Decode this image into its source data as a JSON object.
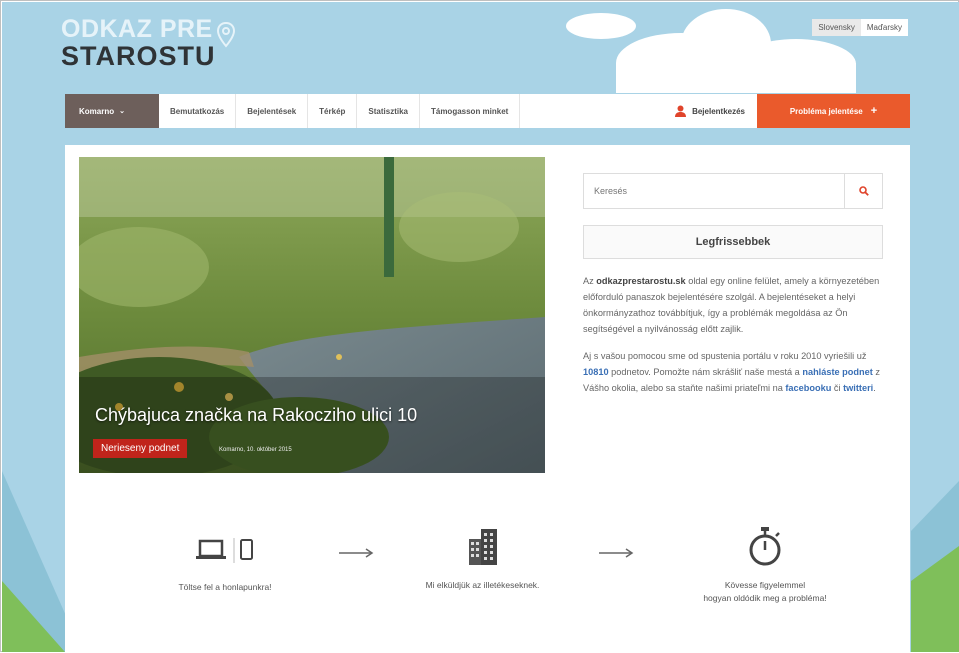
{
  "logo": {
    "line1": "ODKAZ PRE",
    "line2": "STAROSTU"
  },
  "languages": [
    {
      "label": "Slovensky",
      "active": false
    },
    {
      "label": "Maďarsky",
      "active": true
    }
  ],
  "nav": {
    "city": "Komarno",
    "items": [
      "Bemutatkozás",
      "Bejelentések",
      "Térkép",
      "Statisztika",
      "Támogasson minket"
    ],
    "login": "Bejelentkezés",
    "report": "Probléma jelentése"
  },
  "featured": {
    "title": "Chýbajuca značka na Rakocziho ulici 10",
    "status": "Nerieseny podnet",
    "meta": "Komarno, 10. október 2015"
  },
  "search": {
    "placeholder": "Keresés"
  },
  "latest_label": "Legfrissebbek",
  "description": {
    "p1_strong": "odkazprestarostu.sk",
    "p1_pre": "Az",
    "p1_rest": "oldal egy online felület, amely a környezetében előforduló panaszok bejelentésére szolgál. A bejelentéseket a helyi önkormányzathoz továbbítjuk, így a problémák megoldása az Ön segítségével a nyilvánosság előtt zajlik.",
    "p2_pre": "Aj s vašou pomocou sme od spustenia portálu v roku 2010 vyriešili už",
    "p2_count": "10810",
    "p2_mid": "podnetov. Pomožte nám skrášliť naše mestá a",
    "p2_link1": "nahláste podnet",
    "p2_mid2": "z Vášho okolia, alebo sa staňte našimi priateľmi na",
    "p2_link2": "facebooku",
    "p2_or": "či",
    "p2_link3": "twitteri",
    "p2_end": "."
  },
  "steps": [
    {
      "icon": "laptop-phone-icon",
      "text1": "Töltse fel a honlapunkra!",
      "text2": ""
    },
    {
      "icon": "building-icon",
      "text1": "Mi elküldjük az illetékeseknek.",
      "text2": ""
    },
    {
      "icon": "stopwatch-icon",
      "text1": "Kövesse figyelemmel",
      "text2": "hogyan oldódik meg a probléma!"
    }
  ],
  "colors": {
    "accent": "#ea5a2c",
    "nav_city": "#6d5f5b",
    "badge": "#c0241b",
    "sky": "#a9d3e6"
  }
}
